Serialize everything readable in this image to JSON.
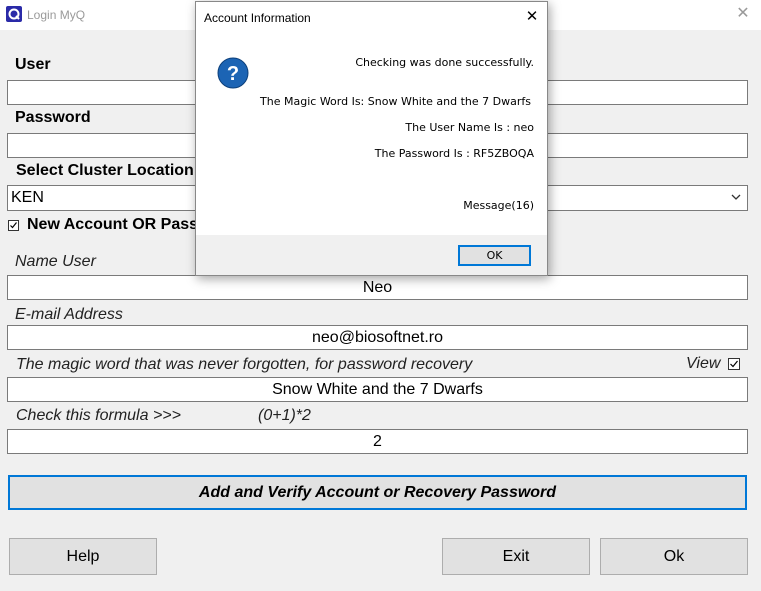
{
  "window": {
    "title": "Login MyQ",
    "close_glyph": "✕"
  },
  "form": {
    "user_label": "User",
    "user_value": "",
    "password_label": "Password",
    "password_value": "",
    "cluster_label": "Select Cluster Location",
    "cluster_value": "KEN",
    "new_account_label": "New Account OR Pass",
    "new_account_checked": true,
    "name_user_label": "Name User",
    "name_user_value": "Neo",
    "email_label": "E-mail Address",
    "email_value": "neo@biosoftnet.ro",
    "magic_label": "The magic word that was never forgotten, for password recovery",
    "view_label": "View",
    "view_checked": true,
    "magic_value": "Snow White and the 7 Dwarfs",
    "formula_label": "Check this formula  >>>",
    "formula_expr": "(0+1)*2",
    "formula_value": "2"
  },
  "buttons": {
    "add_verify": "Add and Verify Account or Recovery Password",
    "help": "Help",
    "exit": "Exit",
    "ok": "Ok"
  },
  "dialog": {
    "title": "Account Information",
    "close_glyph": "✕",
    "icon": "question-icon",
    "icon_glyph": "?",
    "line1": "Checking was done successfully.",
    "line2": "The Magic Word Is: Snow White and the 7 Dwarfs",
    "line3": "The User Name Is : neo",
    "line4": "The Password Is : RF5ZBOQA",
    "line5": "Message(16)",
    "ok": "OK"
  },
  "colors": {
    "accent": "#0078d7",
    "icon_blue": "#1c64b4"
  }
}
